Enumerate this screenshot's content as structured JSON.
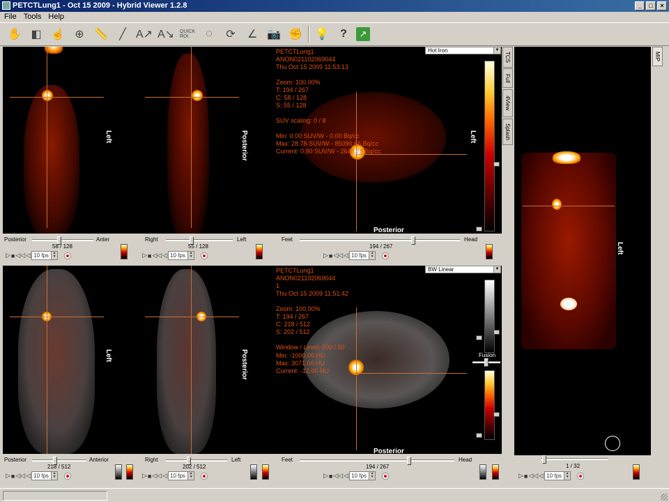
{
  "window": {
    "title": "PETCTLung1 - Oct 15 2009 - Hybrid Viewer 1.2.8",
    "min": "_",
    "max": "□",
    "close": "×"
  },
  "menu": [
    "File",
    "Tools",
    "Help"
  ],
  "toolbar_icons": [
    "hand-icon",
    "cube-icon",
    "pan-icon",
    "zoom-icon",
    "ruler-icon",
    "line-icon",
    "annotate-icon",
    "text-annotate-icon",
    "quick-roi-icon",
    "freehand-roi-icon",
    "rotate-icon",
    "angle-icon",
    "camera-icon",
    "hand-reset-icon",
    "tip-icon",
    "help-icon",
    "exit-icon"
  ],
  "toolbar": {
    "quick_roi": "QUICK\nROI"
  },
  "pet_top": {
    "lut": "Hot Iron",
    "info": "PETCTLung1\nANON021102069044\nThu Oct 15 2009 11:53:13\n\nZoom: 100.00%\nT: 194 / 267\nC: 58 / 128\nS: 55 / 128\n\nSUV scaling: 0 / 8\n\nMin: 0.00 SUV/W - 0.00 Bq/cc\nMax: 28.78 SUV/W - 85090.66 Bq/cc\nCurrent: 0.90 SUV/W - 2648.78 Bq/cc",
    "coronal": {
      "orient": "Left",
      "left": "Posterior",
      "right": "Anter",
      "slice": "58 / 128",
      "fps": "10 fps"
    },
    "sagittal": {
      "orient": "Posterior",
      "left": "Right",
      "right": "Left",
      "slice": "55 / 128",
      "fps": "10 fps"
    },
    "axial": {
      "orient_side": "Left",
      "orient_bottom": "Posterior",
      "left": "Feet",
      "right": "Head",
      "slice": "194 / 267",
      "fps": "10 fps"
    }
  },
  "fusion_bottom": {
    "lut": "BW Linear",
    "fusion_label": "Fusion",
    "info_a": "PETCTLung1\nANON021102069044\n1\nThu Oct 15 2009 11:51:42\n\nZoom: 100.00%\nT: 194 / 267\nC: 218 / 512\nS: 202 / 512\n\nWindow / Level: 500 / 50",
    "info_b": "Min: -1000.00 HU\nMax: 3071.00 HU\nCurrent: -12.00 HU",
    "coronal": {
      "orient": "Left",
      "left": "Posterior",
      "right": "Anterior",
      "slice": "218 / 512",
      "fps": "10 fps"
    },
    "sagittal": {
      "orient": "Posterior",
      "left": "Right",
      "right": "Left",
      "slice": "202 / 512",
      "fps": "10 fps"
    },
    "axial": {
      "orient_bottom": "Posterior",
      "left": "Feet",
      "right": "Head",
      "slice": "194 / 267",
      "fps": "10 fps"
    }
  },
  "side_tabs": [
    "TCS",
    "Full",
    "4View",
    "Splash"
  ],
  "mip": {
    "tab": "MIP",
    "orient": "Left",
    "slice": "1 / 32",
    "fps": "10 fps"
  },
  "transport": [
    "▷",
    "■",
    "◁◁",
    "◁"
  ]
}
